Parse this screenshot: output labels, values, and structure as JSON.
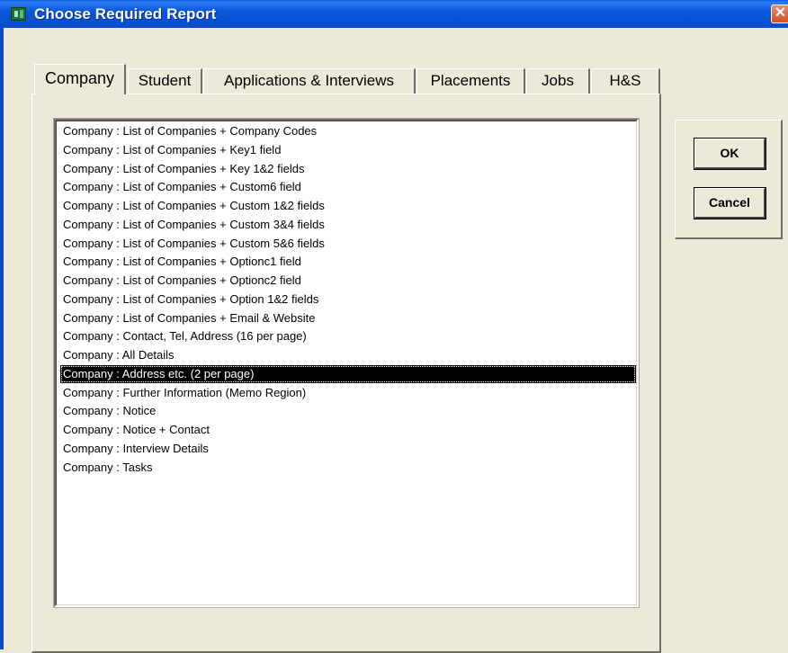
{
  "window": {
    "title": "Choose Required Report",
    "close_glyph": "✕"
  },
  "tabs": [
    {
      "label": "Company",
      "active": true
    },
    {
      "label": "Student",
      "active": false
    },
    {
      "label": "Applications & Interviews",
      "active": false
    },
    {
      "label": "Placements",
      "active": false
    },
    {
      "label": "Jobs",
      "active": false
    },
    {
      "label": "H&S",
      "active": false
    }
  ],
  "report_list": {
    "selected_index": 13,
    "items": [
      "Company : List of Companies + Company Codes",
      "Company : List of Companies + Key1 field",
      "Company : List of Companies + Key 1&2 fields",
      "Company : List of Companies + Custom6 field",
      "Company : List of Companies + Custom 1&2 fields",
      "Company : List of Companies + Custom 3&4 fields",
      "Company : List of Companies + Custom 5&6 fields",
      "Company : List of Companies + Optionc1 field",
      "Company : List of Companies + Optionc2 field",
      "Company : List of Companies + Option 1&2 fields",
      "Company : List of Companies + Email & Website",
      "Company : Contact, Tel,  Address (16 per page)",
      "Company : All Details",
      "Company : Address etc. (2 per page)",
      "Company : Further Information (Memo Region)",
      "Company : Notice",
      "Company : Notice + Contact",
      "Company : Interview Details",
      "Company : Tasks"
    ]
  },
  "buttons": {
    "ok_label": "OK",
    "cancel_label": "Cancel"
  }
}
